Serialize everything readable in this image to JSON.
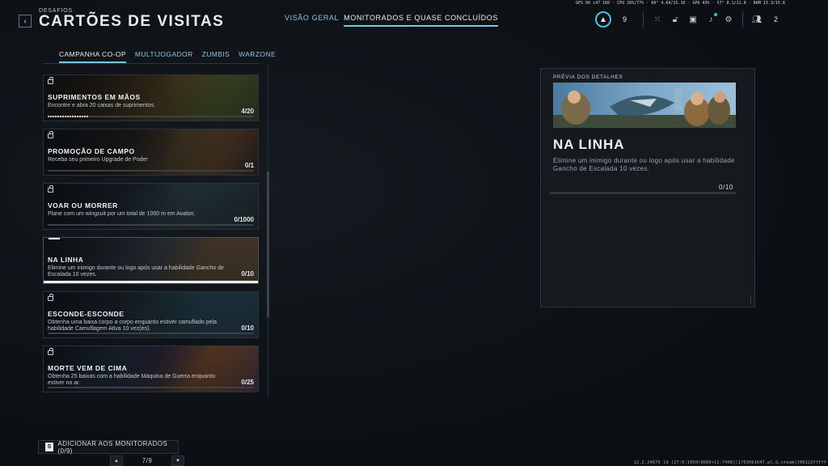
{
  "header": {
    "breadcrumb": "DESAFIOS",
    "title": "CARTÕES DE VISITAS",
    "back_icon": "chevron-left-icon"
  },
  "top_tabs": [
    {
      "label": "VISÃO GERAL",
      "active": false
    },
    {
      "label": "MONITORADOS E QUASE CONCLUÍDOS",
      "active": true
    }
  ],
  "perf_overlay": "GPS 60  i47 160  ·  CPU 26%/77%  ·  60°  4.64/15.16  ·  GPU 43%  ·  57°  8.1/11.8  ·  RAM 13.3/15.8",
  "hud": {
    "rank_value": "9",
    "friends_count": "2",
    "icons": [
      "grid-icon",
      "unlock-icon",
      "camera-icon",
      "bell-icon",
      "gear-icon",
      "friends-icon"
    ]
  },
  "categories": [
    {
      "label": "CAMPANHA CO-OP",
      "active": true
    },
    {
      "label": "MULTIJOGADOR",
      "active": false
    },
    {
      "label": "ZUMBIS",
      "active": false
    },
    {
      "label": "WARZONE",
      "active": false
    }
  ],
  "cards": [
    {
      "title": "SUPRIMENTOS EM MÃOS",
      "desc": "Encontre e abra 20 caixas de suprimentos.",
      "progress": "4/20",
      "fraction": 0.2,
      "selected": false
    },
    {
      "title": "PROMOÇÃO DE CAMPO",
      "desc": "Receba seu primeiro Upgrade de Poder",
      "progress": "0/1",
      "fraction": 0,
      "selected": false
    },
    {
      "title": "VOAR OU MORRER",
      "desc": "Plane com um wingsuit por um total de 1000 m em Avalon.",
      "progress": "0/1000",
      "fraction": 0,
      "selected": false
    },
    {
      "title": "NA LINHA",
      "desc": "Elimine um inimigo durante ou logo após usar a habilidade Gancho de Escalada 10 vezes.",
      "progress": "0/10",
      "fraction": 0,
      "selected": true
    },
    {
      "title": "ESCONDE-ESCONDE",
      "desc": "Obtenha uma baixa corpo a corpo enquanto estiver camuflado pela habilidade Camuflagem Ativa 10 vez(es).",
      "progress": "0/10",
      "fraction": 0,
      "selected": false
    },
    {
      "title": "MORTE VEM DE CIMA",
      "desc": "Obtenha 25 baixas com a habilidade Máquina de Guerra enquanto estiver no ar.",
      "progress": "0/25",
      "fraction": 0,
      "selected": false
    }
  ],
  "preview": {
    "label": "PRÉVIA DOS DETALHES",
    "title": "NA LINHA",
    "desc": "Elimine um inimigo durante ou logo após usar a habilidade Gancho de Escalada 10 vezes.",
    "progress": "0/10"
  },
  "footer": {
    "track_key": "S",
    "track_label": "ADICIONAR AOS MONITORADOS (0/9)",
    "page": "7/9",
    "build_info": "12.2.24679 19 [27:0:1050|0689+11:7408][1763661647.pl.G.steam][00122fffff"
  },
  "colors": {
    "accent": "#7cc3e8",
    "background": "#0d1014"
  }
}
